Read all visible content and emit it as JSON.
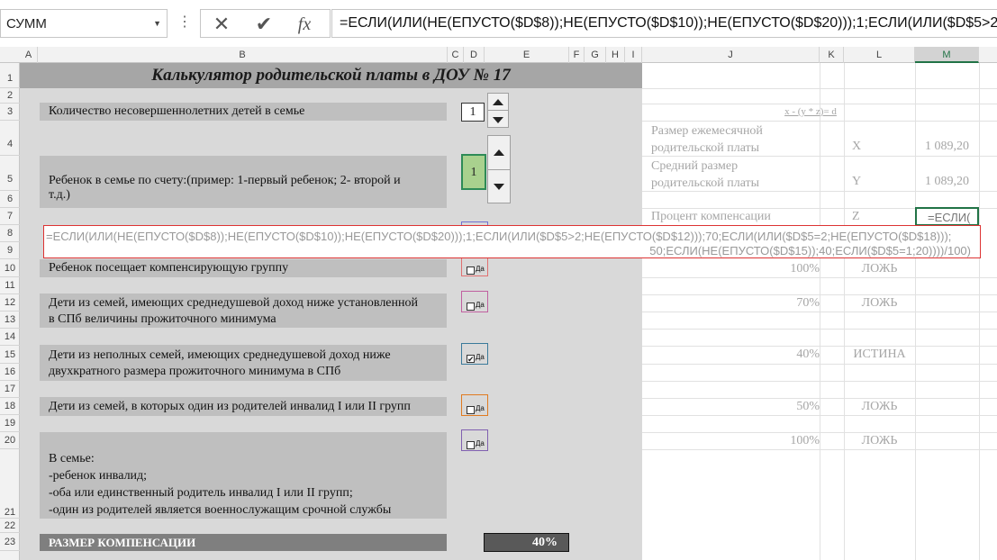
{
  "formula_bar": {
    "name_box": "СУММ",
    "dots_icon": "⋮",
    "cancel_icon": "✕",
    "enter_icon": "✔",
    "fx_icon": "fx",
    "formula": "=ЕСЛИ(ИЛИ(НЕ(ЕПУСТО($D$8));НЕ(ЕПУСТО($D$10));НЕ(ЕПУСТО($D$20)));1;ЕСЛИ(ИЛИ($D$5>2;НЕ"
  },
  "columns": [
    "A",
    "B",
    "C",
    "D",
    "E",
    "F",
    "G",
    "H",
    "I",
    "J",
    "K",
    "L",
    "M"
  ],
  "rows": [
    "1",
    "2",
    "3",
    "4",
    "5",
    "6",
    "7",
    "8",
    "9",
    "10",
    "11",
    "12",
    "13",
    "14",
    "15",
    "16",
    "17",
    "18",
    "19",
    "20",
    "21",
    "22",
    "23"
  ],
  "title": "Калькулятор родительской платы в ДОУ № 17",
  "labels": {
    "children_count": "Количество несовершеннолетних детей в семье",
    "child_order_1": "Ребенок в семье по счету:(пример: 1-первый ребенок; 2- второй и",
    "child_order_2": "т.д.)",
    "comp_group": "Ребенок посещает компенсирующую группу",
    "low_income_1": "Дети из семей, имеющих среднедушевой доход ниже установленной",
    "low_income_2": "в СПб величины прожиточного минимума",
    "single_parent_1": "Дети из неполных семей, имеющих среднедушевой доход ниже",
    "single_parent_2": "двухкратного размера прожиточного минимума в СПб",
    "parent_disabled": "Дети из семей, в которых один из родителей инвалид I или II групп",
    "family_1": "В семье:",
    "family_2": "-ребенок инвалид;",
    "family_3": "-оба или единственный родитель инвалид I или II групп;",
    "family_4": "-один из родителей является военнослужащим срочной службы",
    "compensation": "РАЗМЕР КОМПЕНСАЦИИ"
  },
  "spinners": {
    "children_count_value": "1",
    "child_order_value": "1"
  },
  "checkbox_text": "Да",
  "checked_mark": "✔",
  "result_value": "40%",
  "right_panel": {
    "formula_note": "x - (y * z)= d",
    "monthly_fee_1": "Размер ежемесячной",
    "monthly_fee_2": "родительской платы",
    "avg_fee_1": "Средний размер",
    "avg_fee_2": "родительской платы",
    "percent_label": "Процент компенсации",
    "var_x": "X",
    "var_y": "Y",
    "var_z": "Z",
    "x_value": "1 089,20",
    "y_value": "1 089,20",
    "editing_cell": "=ЕСЛИ(",
    "r10_pct": "100%",
    "r10_bool": "ЛОЖЬ",
    "r12_pct": "70%",
    "r12_bool": "ЛОЖЬ",
    "r15_pct": "40%",
    "r15_bool": "ИСТИНА",
    "r18_pct": "50%",
    "r18_bool": "ЛОЖЬ",
    "r20_pct": "100%",
    "r20_bool": "ЛОЖЬ"
  },
  "edit_popup": {
    "line1": "=ЕСЛИ(ИЛИ(НЕ(ЕПУСТО($D$8));НЕ(ЕПУСТО($D$10));НЕ(ЕПУСТО($D$20)));1;ЕСЛИ(ИЛИ($D$5>2;НЕ(ЕПУСТО($D$12)));70;ЕСЛИ(ИЛИ($D$5=2;НЕ(ЕПУСТО($D$18)));",
    "line2": "50;ЕСЛИ(НЕ(ЕПУСТО($D$15));40;ЕСЛИ($D$5=1;20))))/100)"
  },
  "colors": {
    "grid_accent": "#217346",
    "sheet_grey": "#d9d9d9",
    "label_grey": "#bfbfbf",
    "title_grey": "#a6a6a6",
    "cb_red": "#e07070",
    "cb_pink": "#c060a0",
    "cb_teal": "#3a7a9a",
    "cb_orange": "#e07a20",
    "cb_purple": "#8060b0",
    "cb_blue": "#7070d0"
  }
}
